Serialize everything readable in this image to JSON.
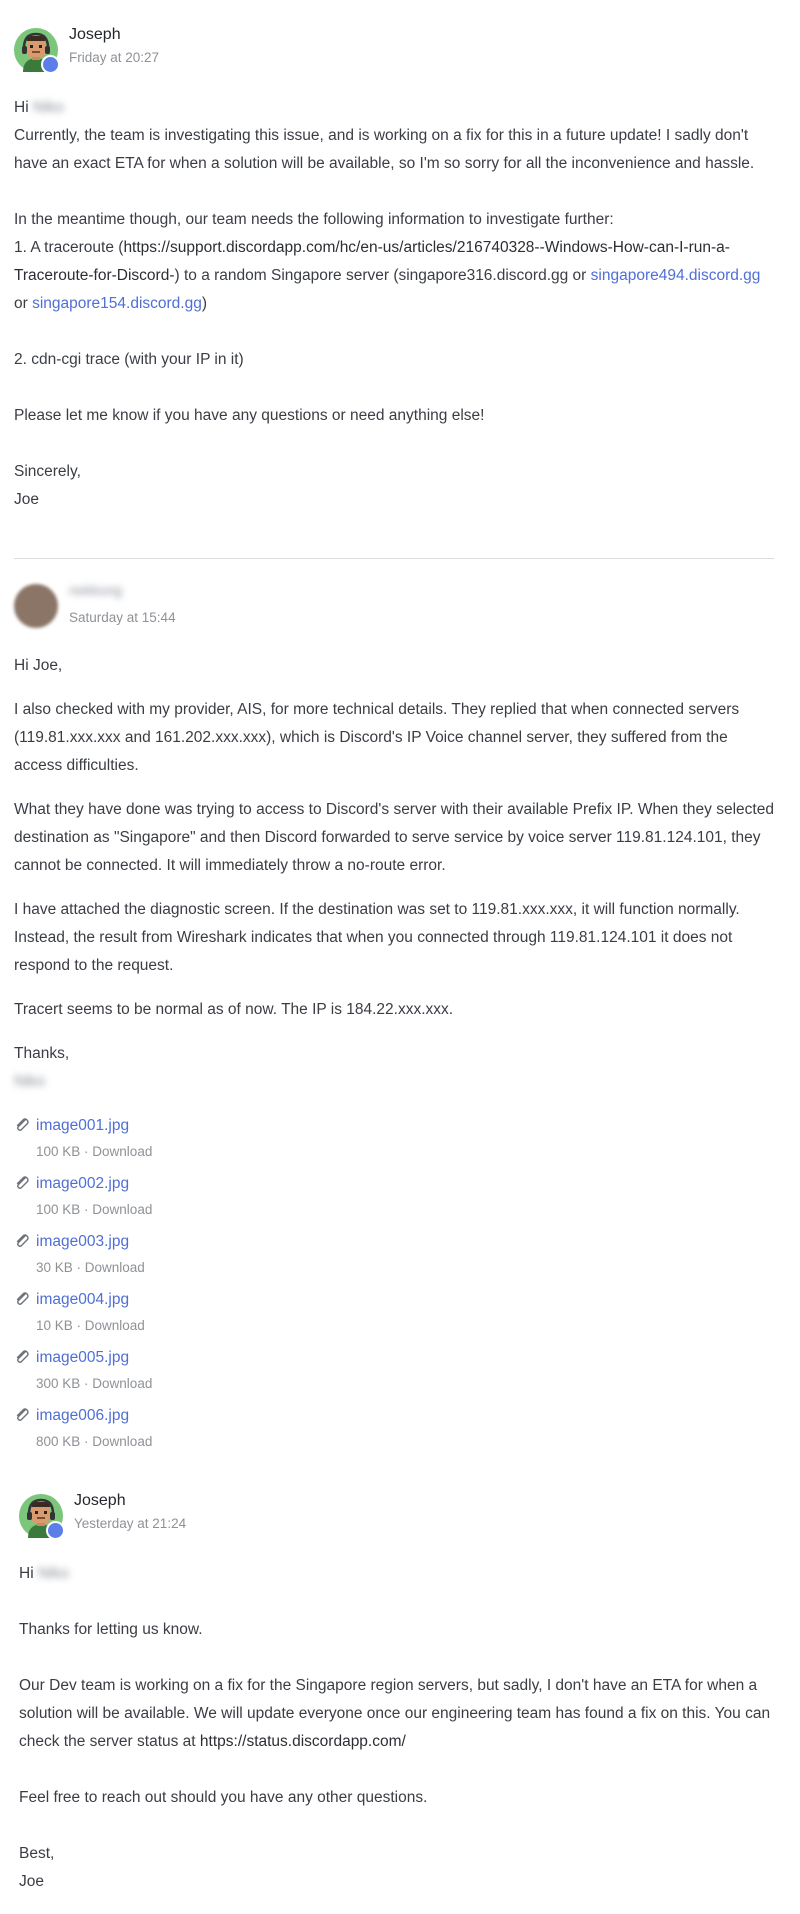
{
  "messages": [
    {
      "author": "Joseph",
      "time": "Friday at 20:27",
      "greeting": "Hi",
      "greeting_name": "Niko",
      "p1": "Currently, the team is investigating this issue, and is working on a fix for this in a future update! I sadly don't have an exact ETA for when a solution will be available, so I'm so sorry for all the inconvenience and hassle.",
      "p2": "In the meantime though, our team needs the following information to investigate further:",
      "item1_prefix": "1. A traceroute (",
      "item1_url": "https://support.discordapp.com/hc/en-us/articles/216740328--Windows-How-can-I-run-a-Traceroute-for-Discord-",
      "item1_mid": ") to a random Singapore server (singapore316.discord.gg or ",
      "item1_link2": "singapore494.discord.gg",
      "item1_or": " or ",
      "item1_link3": "singapore154.discord.gg",
      "item1_end": ")",
      "item2": "2. cdn-cgi trace (with your IP in it)",
      "p3": "Please let me know if you have any questions or need anything else!",
      "signoff": "Sincerely,",
      "signature": "Joe"
    },
    {
      "author": "nekkung",
      "time": "Saturday at 15:44",
      "p1": "Hi Joe,",
      "p2": "I also checked with my provider, AIS, for more technical details. They replied that when connected servers (119.81.xxx.xxx and 161.202.xxx.xxx), which is Discord's IP Voice channel server, they suffered from the access difficulties.",
      "p3": "What they have done was trying to access to Discord's server with their available Prefix IP. When they selected destination as \"Singapore\" and then Discord forwarded to serve service by voice server 119.81.124.101, they cannot be connected. It will immediately throw a no-route error.",
      "p4": "I have attached the diagnostic screen. If the destination was set to 119.81.xxx.xxx, it will function normally. Instead, the result from Wireshark indicates that when you connected through 119.81.124.101 it does not respond to the request.",
      "p5": "Tracert seems to be normal as of now. The IP is 184.22.xxx.xxx.",
      "signoff": "Thanks,",
      "signature": "Niko",
      "download_label": "Download",
      "attachments": [
        {
          "name": "image001.jpg",
          "size": "100 KB"
        },
        {
          "name": "image002.jpg",
          "size": "100 KB"
        },
        {
          "name": "image003.jpg",
          "size": "30 KB"
        },
        {
          "name": "image004.jpg",
          "size": "10 KB"
        },
        {
          "name": "image005.jpg",
          "size": "300 KB"
        },
        {
          "name": "image006.jpg",
          "size": "800 KB"
        }
      ]
    },
    {
      "author": "Joseph",
      "time": "Yesterday at 21:24",
      "greeting": "Hi",
      "greeting_name": "Niko",
      "p1": "Thanks for letting us know.",
      "p2_prefix": "Our Dev team is working on a fix for the Singapore region servers, but sadly, I don't have an ETA for when a solution will be available. We will update everyone once our engineering team has found a fix on this. You can check the server status at ",
      "p2_url": "https://status.discordapp.com/",
      "p3": "Feel free to reach out should you have any other questions.",
      "signoff": "Best,",
      "signature": "Joe"
    }
  ],
  "colors": {
    "link": "#4f6fd6",
    "text": "#3a3d44",
    "meta": "#8e9297",
    "badge": "#5b7ee8"
  }
}
